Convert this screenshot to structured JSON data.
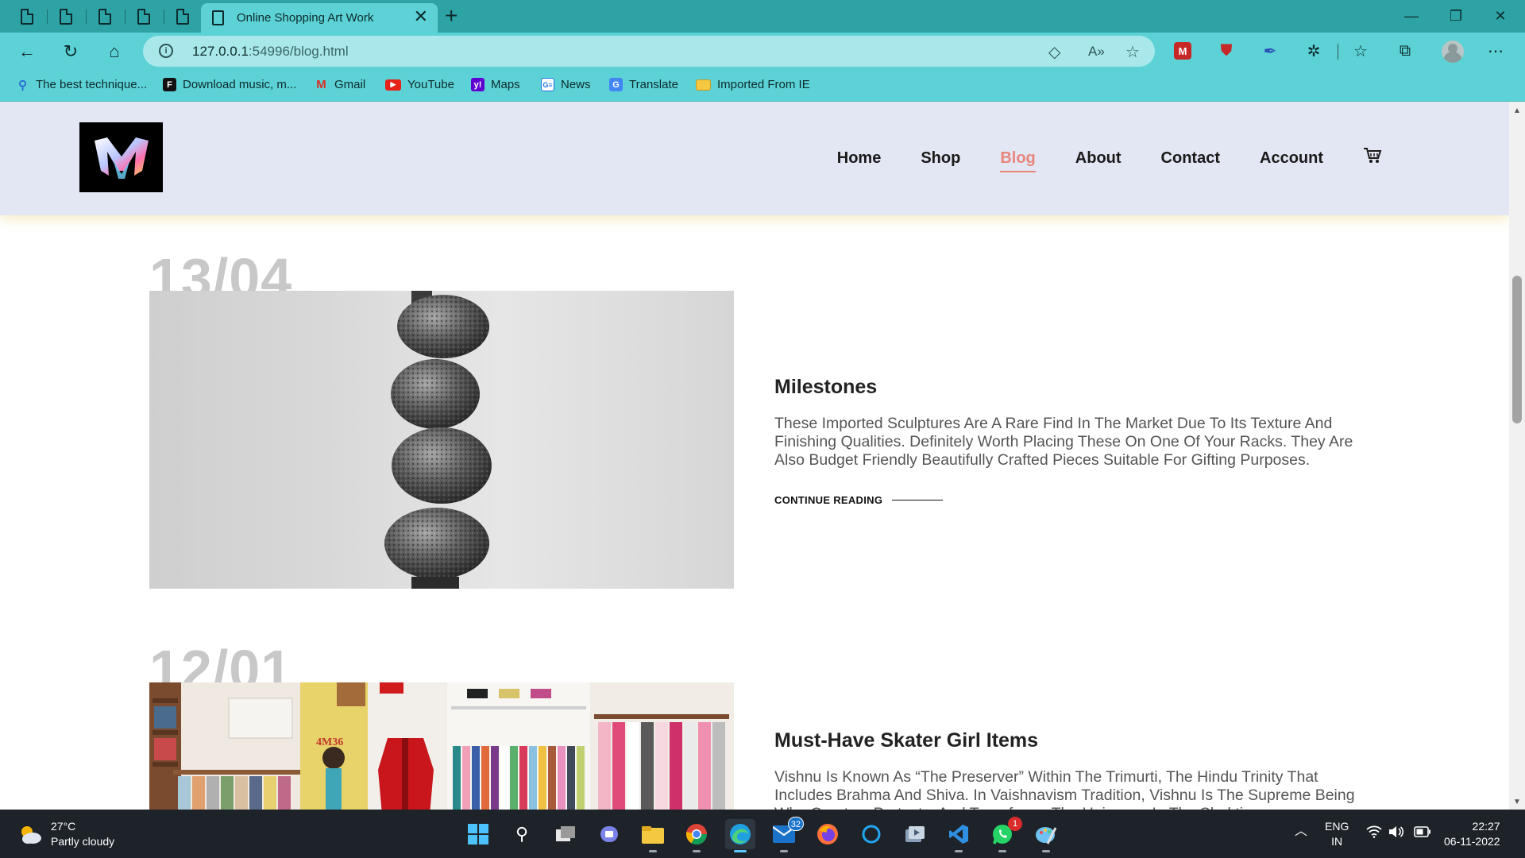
{
  "browser": {
    "tab_title": "Online Shopping Art Work",
    "url_host": "127.0.0.1",
    "url_rest": ":54996/blog.html",
    "bookmarks": [
      {
        "label": "The best technique...",
        "icon": "search-icon"
      },
      {
        "label": "Download music, m...",
        "icon": "f-logo-icon"
      },
      {
        "label": "Gmail",
        "icon": "gmail-icon"
      },
      {
        "label": "YouTube",
        "icon": "youtube-icon"
      },
      {
        "label": "Maps",
        "icon": "yahoo-icon"
      },
      {
        "label": "News",
        "icon": "news-icon"
      },
      {
        "label": "Translate",
        "icon": "translate-icon"
      },
      {
        "label": "Imported From IE",
        "icon": "folder-icon"
      }
    ]
  },
  "site": {
    "nav": [
      {
        "label": "Home"
      },
      {
        "label": "Shop"
      },
      {
        "label": "Blog"
      },
      {
        "label": "About"
      },
      {
        "label": "Contact"
      },
      {
        "label": "Account"
      }
    ],
    "active_nav": "Blog",
    "accent_color": "#e8867c",
    "header_bg": "#e3e6f3"
  },
  "posts": [
    {
      "date": "13/04",
      "title": "Milestones",
      "text": "These Imported Sculptures Are A Rare Find In The Market Due To Its Texture And Finishing Qualities. Definitely Worth Placing These On One Of Your Racks. They Are Also Budget Friendly Beautifully Crafted Pieces Suitable For Gifting Purposes.",
      "more": "CONTINUE READING"
    },
    {
      "date": "12/01",
      "title": "Must-Have Skater Girl Items",
      "text": "Vishnu Is Known As “The Preserver” Within The Trimurti, The Hindu Trinity That Includes Brahma And Shiva. In Vaishnavism Tradition, Vishnu Is The Supreme Being Who Creates, Protects, And Transforms The Universe. In The Shaktism",
      "poster_text": "4M36"
    }
  ],
  "taskbar": {
    "weather_temp": "27°C",
    "weather_desc": "Partly cloudy",
    "mail_badge": "32",
    "whatsapp_badge": "1",
    "lang_1": "ENG",
    "lang_2": "IN",
    "time": "22:27",
    "date": "06-11-2022"
  }
}
